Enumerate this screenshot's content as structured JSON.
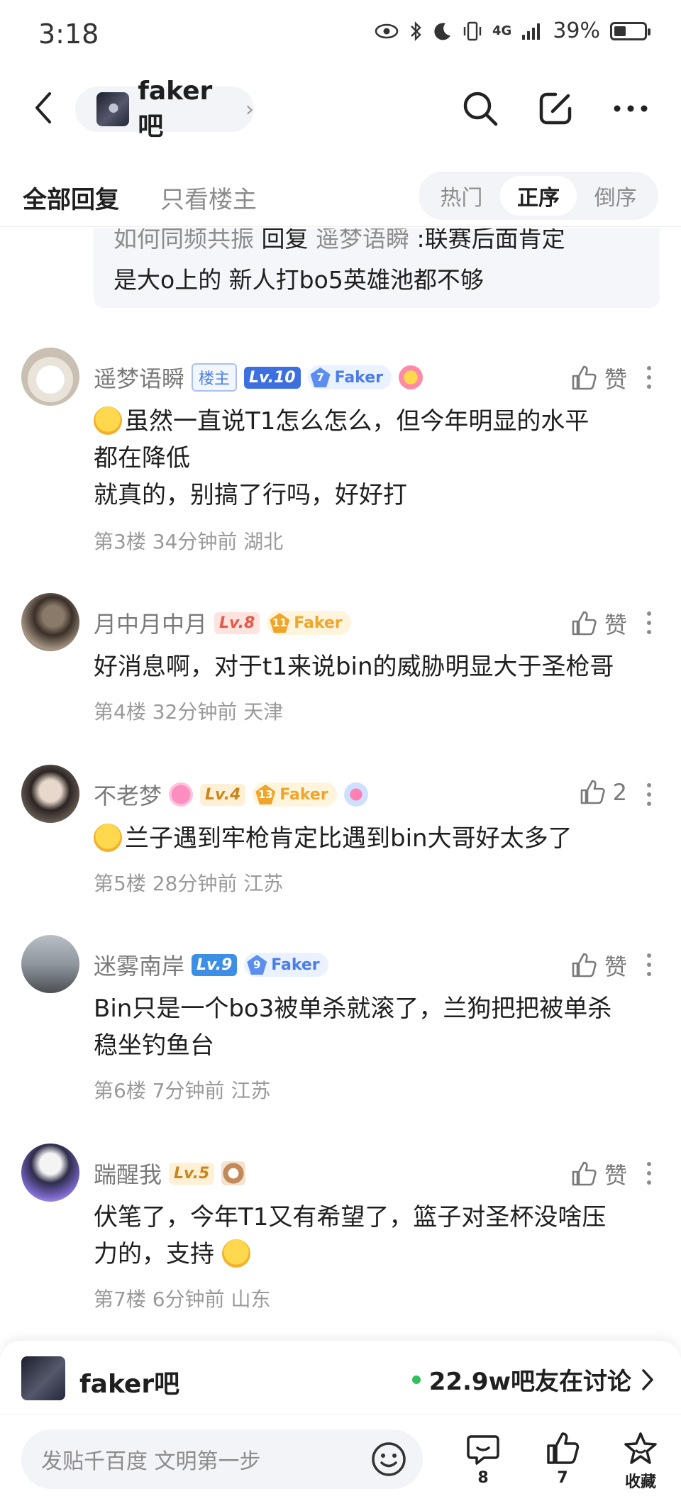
{
  "status_bar": {
    "time": "3:18",
    "battery": "39%",
    "network": "4G",
    "battery_level": 0.39
  },
  "top_nav": {
    "forum_name": "faker吧"
  },
  "reply_tabs": {
    "all": "全部回复",
    "op_only": "只看楼主"
  },
  "order_tabs": [
    {
      "label": "热门",
      "active": false
    },
    {
      "label": "正序",
      "active": true
    },
    {
      "label": "倒序",
      "active": false
    }
  ],
  "quote": {
    "author": "如何同频共振",
    "reply_word": "回复",
    "target": "遥梦语瞬",
    "line1_text": ":联赛后面肯定",
    "line2_text": "是大o上的 新人打bo5英雄池都不够"
  },
  "comments": [
    {
      "username": "遥梦语瞬",
      "op_badge": "楼主",
      "level": "Lv.10",
      "fan_level": "7",
      "fan_name": "Faker",
      "line1": "虽然一直说T1怎么怎么，但今年明显的水平",
      "line2": "都在降低",
      "line3": "就真的，别搞了行吗，好好打",
      "floor": "第3楼",
      "time": "34分钟前",
      "location": "湖北",
      "like": "赞"
    },
    {
      "username": "月中月中月",
      "level": "Lv.8",
      "fan_level": "11",
      "fan_name": "Faker",
      "line1": "好消息啊，对于t1来说bin的威胁明显大于圣枪哥",
      "floor": "第4楼",
      "time": "32分钟前",
      "location": "天津",
      "like": "赞"
    },
    {
      "username": "不老梦",
      "level": "Lv.4",
      "fan_level": "13",
      "fan_name": "Faker",
      "line1": "兰子遇到牢枪肯定比遇到bin大哥好太多了",
      "floor": "第5楼",
      "time": "28分钟前",
      "location": "江苏",
      "like": "2"
    },
    {
      "username": "迷雾南岸",
      "level": "Lv.9",
      "fan_level": "9",
      "fan_name": "Faker",
      "line1": "Bin只是一个bo3被单杀就滚了，兰狗把把被单杀",
      "line2": "稳坐钓鱼台",
      "floor": "第6楼",
      "time": "7分钟前",
      "location": "江苏",
      "like": "赞"
    },
    {
      "username": "踹醒我",
      "level": "Lv.5",
      "line1": "伏笔了，今年T1又有希望了，篮子对圣杯没啥压",
      "line2": "力的，支持",
      "floor": "第7楼",
      "time": "6分钟前",
      "location": "山东",
      "like": "赞"
    }
  ],
  "forum_banner": {
    "name": "faker吧",
    "discussing": "22.9w吧友在讨论"
  },
  "bottom_bar": {
    "input_placeholder": "发贴千百度 文明第一步",
    "comments_count": "8",
    "likes_count": "7",
    "favorite_label": "收藏"
  },
  "colors": {
    "accent_blue": "#4a7de6",
    "online_green": "#32c15c",
    "fan_gold": "#f0a52a",
    "fan_blue": "#5b8ef0"
  },
  "icons": [
    "back-arrow-icon",
    "search-icon",
    "edit-icon",
    "more-icon",
    "thumb-up-icon",
    "more-dots-icon",
    "chevron-right-icon",
    "smile-icon",
    "comment-icon",
    "star-icon"
  ]
}
